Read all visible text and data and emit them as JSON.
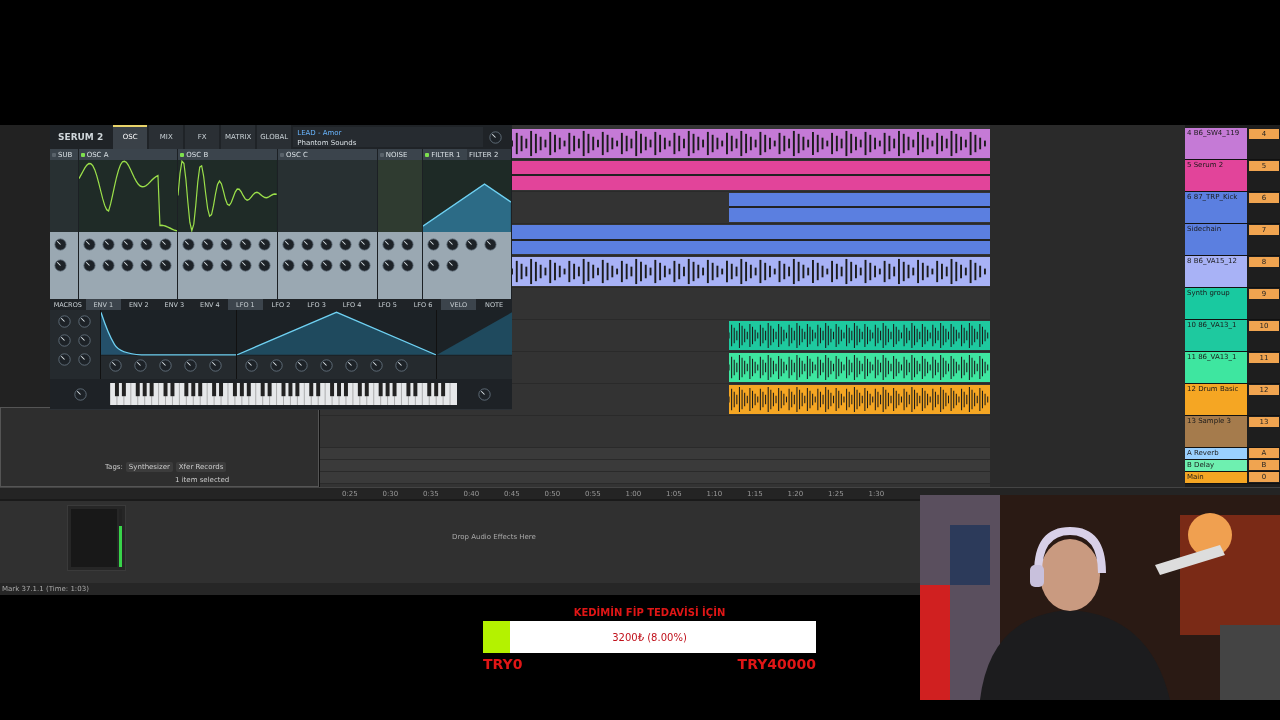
{
  "serum": {
    "logo": "SERUM 2",
    "tabs": [
      {
        "label": "OSC",
        "selected": true
      },
      {
        "label": "MIX",
        "selected": false
      },
      {
        "label": "FX",
        "selected": false
      },
      {
        "label": "MATRIX",
        "selected": false
      },
      {
        "label": "GLOBAL",
        "selected": false
      }
    ],
    "preset": "LEAD - Amor",
    "artist": "Phantom Sounds",
    "sections": [
      {
        "title": "SUB",
        "kind": "sub",
        "on": false
      },
      {
        "title": "OSC A",
        "kind": "wave",
        "on": true
      },
      {
        "title": "OSC B",
        "kind": "wave2",
        "on": true
      },
      {
        "title": "OSC C",
        "kind": "empty",
        "on": false
      },
      {
        "title": "NOISE",
        "kind": "noise",
        "on": false
      },
      {
        "title": "FILTER 1",
        "kind": "filter",
        "on": true
      }
    ],
    "filter2": "FILTER 2",
    "mod_tabs": [
      {
        "label": "MACROS",
        "selected": false
      },
      {
        "label": "ENV 1",
        "selected": true
      },
      {
        "label": "ENV 2",
        "selected": false
      },
      {
        "label": "ENV 3",
        "selected": false
      },
      {
        "label": "ENV 4",
        "selected": false
      },
      {
        "label": "LFO 1",
        "selected": true
      },
      {
        "label": "LFO 2",
        "selected": false
      },
      {
        "label": "LFO 3",
        "selected": false
      },
      {
        "label": "LFO 4",
        "selected": false
      },
      {
        "label": "LFO 5",
        "selected": false
      },
      {
        "label": "LFO 6",
        "selected": false
      },
      {
        "label": "VELO",
        "selected": true
      },
      {
        "label": "NOTE",
        "selected": false
      }
    ]
  },
  "tracks": [
    {
      "name": "4 B6_SW4_119",
      "color": "#c57ad6",
      "number": "4",
      "clip": {
        "kind": "full_wave"
      }
    },
    {
      "name": "5 Serum 2",
      "color": "#e2449a",
      "number": "5",
      "clip": {
        "kind": "full"
      }
    },
    {
      "name": "6 87_TRP_Kick",
      "color": "#5b7fe0",
      "number": "6",
      "clip": {
        "kind": "late"
      }
    },
    {
      "name": "Sidechain",
      "color": "#5b7fe0",
      "number": "7",
      "clip": {
        "kind": "full"
      }
    },
    {
      "name": "8 B6_VA15_12",
      "color": "#a8b2f6",
      "number": "8",
      "clip": {
        "kind": "full_wave"
      }
    },
    {
      "name": "Synth group",
      "color": "#19c9a0",
      "number": "9"
    },
    {
      "name": "10 86_VA13_1",
      "color": "#1ec99f",
      "number": "10",
      "clip": {
        "kind": "late_wave"
      }
    },
    {
      "name": "11 86_VA13_1",
      "color": "#3ee6a0",
      "number": "11",
      "clip": {
        "kind": "late_wave"
      }
    },
    {
      "name": "12 Drum Basic",
      "color": "#f5a623",
      "number": "12",
      "clip": {
        "kind": "late_wave"
      }
    },
    {
      "name": "13 Sample 3",
      "color": "#a57b4c",
      "number": "13"
    }
  ],
  "returns": [
    {
      "name": "A Reverb",
      "color": "#9ad0ff",
      "number": "A"
    },
    {
      "name": "B Delay",
      "color": "#6ef0b0",
      "number": "B"
    },
    {
      "name": "Main",
      "color": "#f5a623",
      "number": "0"
    }
  ],
  "ruler": [
    "0:25",
    "0:30",
    "0:35",
    "0:40",
    "0:45",
    "0:50",
    "0:55",
    "1:00",
    "1:05",
    "1:10",
    "1:15",
    "1:20",
    "1:25",
    "1:30"
  ],
  "browser": {
    "tags_label": "Tags:",
    "tags": [
      "Synthesizer",
      "Xfer Records"
    ],
    "selection": "1 item selected"
  },
  "clip_panel": {
    "level": 0.7
  },
  "drop_hint": "Drop Audio Effects Here",
  "status": "Mark 37.1.1 (Time: 1:03)",
  "donation": {
    "title": "KEDİMİN FİP TEDAVİSİ İÇİN",
    "amount": "3200₺ (8.00%)",
    "level": 0.08,
    "min": "TRY0",
    "max": "TRY40000"
  }
}
